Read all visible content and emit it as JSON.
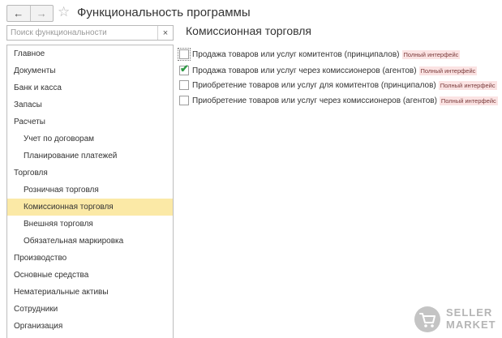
{
  "window": {
    "title": "Функциональность программы",
    "back_icon": "arrow-left-icon",
    "forward_icon": "arrow-right-icon",
    "favorite_icon": "star-icon"
  },
  "search": {
    "placeholder": "Поиск функциональности",
    "value": "",
    "clear_label": "×"
  },
  "sidebar": {
    "items": [
      {
        "label": "Главное",
        "level": 0,
        "selected": false
      },
      {
        "label": "Документы",
        "level": 0,
        "selected": false
      },
      {
        "label": "Банк и касса",
        "level": 0,
        "selected": false
      },
      {
        "label": "Запасы",
        "level": 0,
        "selected": false
      },
      {
        "label": "Расчеты",
        "level": 0,
        "selected": false
      },
      {
        "label": "Учет по договорам",
        "level": 1,
        "selected": false
      },
      {
        "label": "Планирование платежей",
        "level": 1,
        "selected": false
      },
      {
        "label": "Торговля",
        "level": 0,
        "selected": false
      },
      {
        "label": "Розничная торговля",
        "level": 1,
        "selected": false
      },
      {
        "label": "Комиссионная торговля",
        "level": 1,
        "selected": true
      },
      {
        "label": "Внешняя торговля",
        "level": 1,
        "selected": false
      },
      {
        "label": "Обязательная маркировка",
        "level": 1,
        "selected": false
      },
      {
        "label": "Производство",
        "level": 0,
        "selected": false
      },
      {
        "label": "Основные средства",
        "level": 0,
        "selected": false
      },
      {
        "label": "Нематериальные активы",
        "level": 0,
        "selected": false
      },
      {
        "label": "Сотрудники",
        "level": 0,
        "selected": false
      },
      {
        "label": "Организация",
        "level": 0,
        "selected": false
      }
    ]
  },
  "main": {
    "section_title": "Комиссионная торговля",
    "options": [
      {
        "label": "Продажа товаров или услуг комитентов (принципалов)",
        "checked": false,
        "focused": true,
        "badge": "Полный интерфейс"
      },
      {
        "label": "Продажа товаров или услуг через комиссионеров (агентов)",
        "checked": true,
        "focused": false,
        "badge": "Полный интерфейс"
      },
      {
        "label": "Приобретение товаров или услуг для комитентов (принципалов)",
        "checked": false,
        "focused": false,
        "badge": "Полный интерфейс"
      },
      {
        "label": "Приобретение товаров или услуг через комиссионеров (агентов)",
        "checked": false,
        "focused": false,
        "badge": "Полный интерфейс"
      }
    ]
  },
  "watermark": {
    "line1": "SELLER",
    "line2": "MARKET",
    "icon": "shopping-cart-icon",
    "color": "#b5b5b5"
  },
  "colors": {
    "selected_row": "#fbe9a6",
    "badge_bg": "#fbe3e3",
    "check": "#2f9a45"
  }
}
